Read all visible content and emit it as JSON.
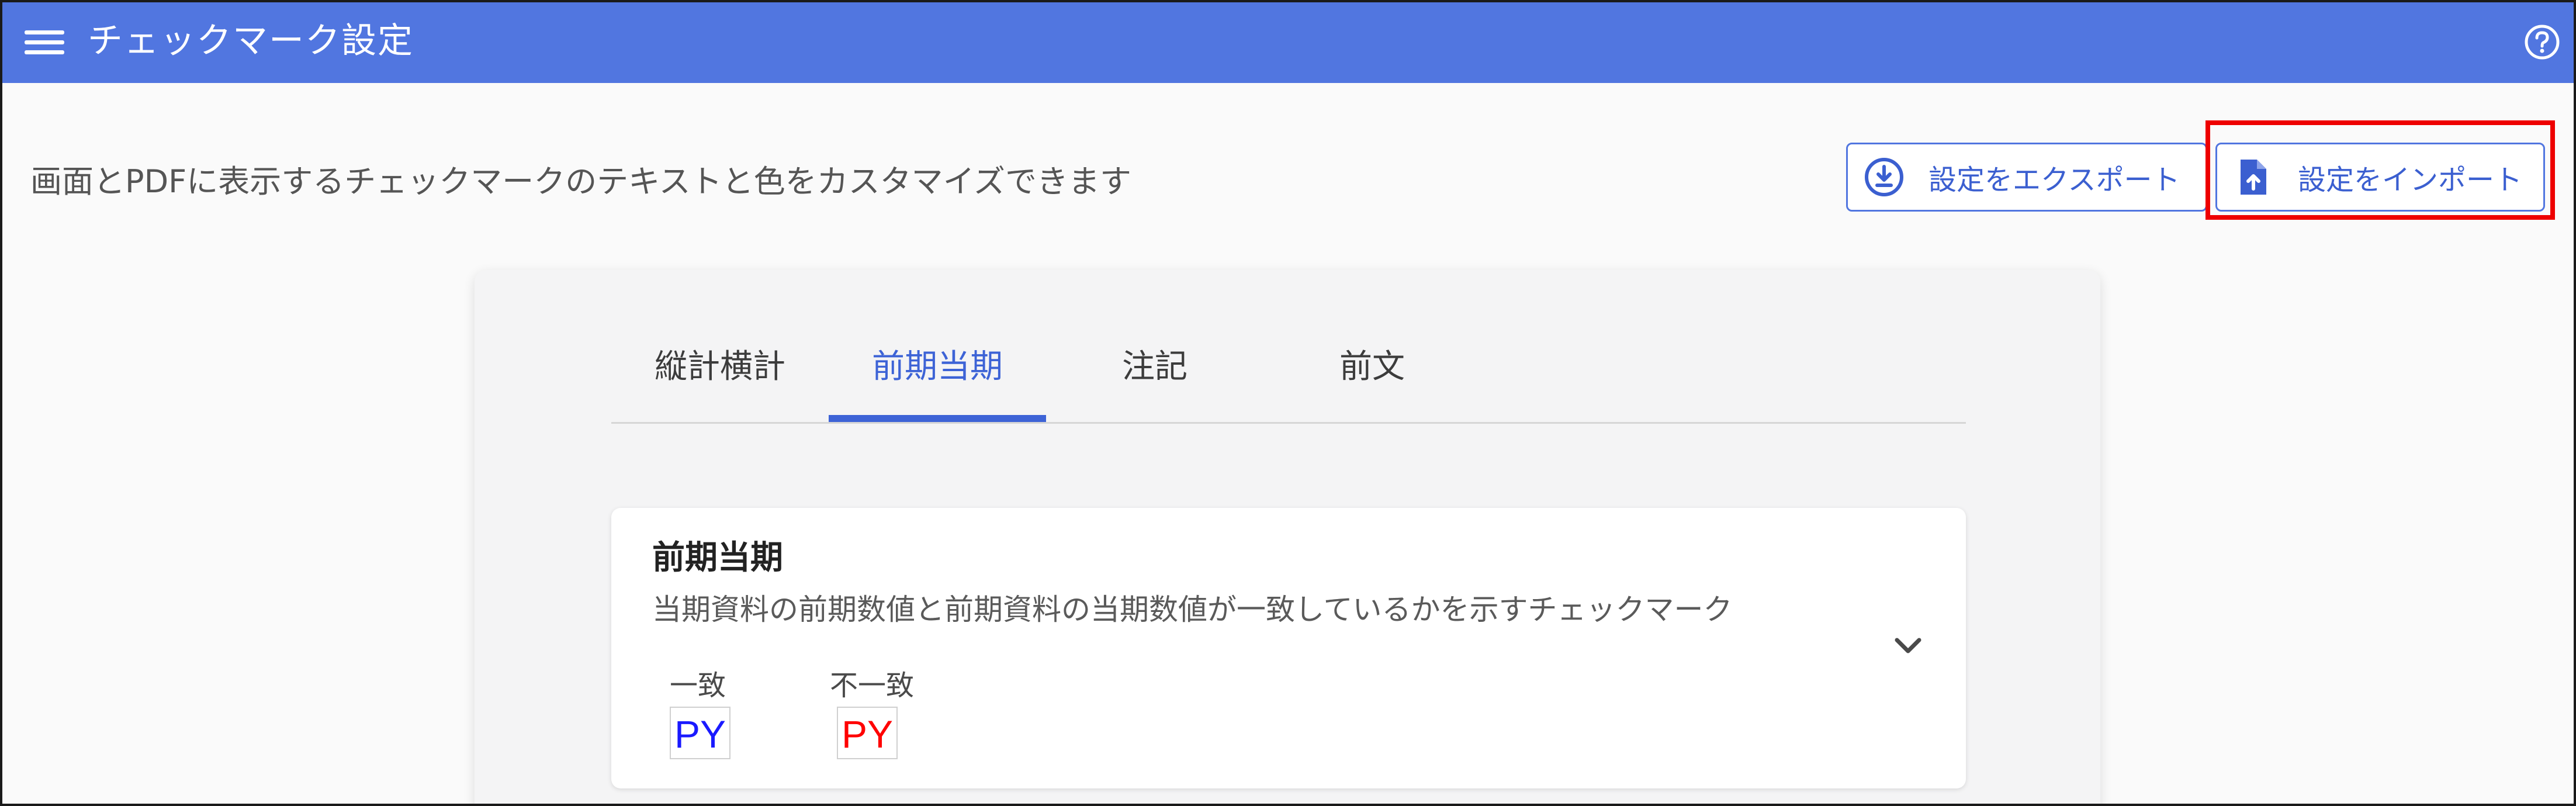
{
  "header": {
    "title": "チェックマーク設定",
    "menu_icon": "hamburger-menu-icon",
    "help_icon": "help-circle-icon"
  },
  "description": "画面とPDFに表示するチェックマークのテキストと色をカスタマイズできます",
  "actions": {
    "export_label": "設定をエクスポート",
    "export_icon": "download-circle-icon",
    "import_label": "設定をインポート",
    "import_icon": "file-upload-icon"
  },
  "tabs": [
    {
      "label": "縦計横計",
      "active": false
    },
    {
      "label": "前期当期",
      "active": true
    },
    {
      "label": "注記",
      "active": false
    },
    {
      "label": "前文",
      "active": false
    }
  ],
  "card": {
    "title": "前期当期",
    "subtitle": "当期資料の前期数値と前期資料の当期数値が一致しているかを示すチェックマーク",
    "match_label": "一致",
    "mismatch_label": "不一致",
    "match_mark": {
      "text": "PY",
      "color": "#1a1aff"
    },
    "mismatch_mark": {
      "text": "PY",
      "color": "#ff0000"
    },
    "expand_icon": "chevron-down-icon"
  },
  "colors": {
    "header_bg": "#5176e0",
    "accent": "#3d63d6",
    "highlight": "#ee0000"
  }
}
